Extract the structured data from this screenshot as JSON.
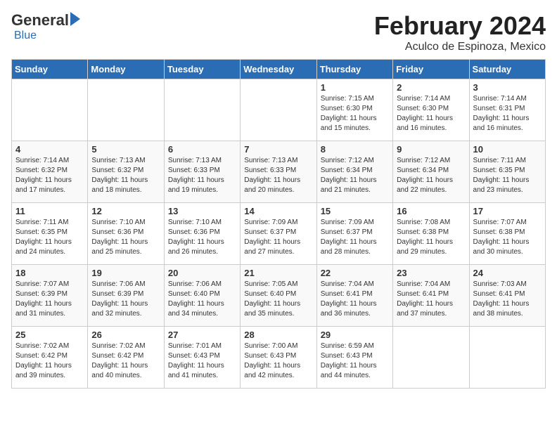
{
  "logo": {
    "general": "General",
    "blue": "Blue"
  },
  "header": {
    "month": "February 2024",
    "location": "Aculco de Espinoza, Mexico"
  },
  "weekdays": [
    "Sunday",
    "Monday",
    "Tuesday",
    "Wednesday",
    "Thursday",
    "Friday",
    "Saturday"
  ],
  "weeks": [
    [
      {
        "day": "",
        "info": ""
      },
      {
        "day": "",
        "info": ""
      },
      {
        "day": "",
        "info": ""
      },
      {
        "day": "",
        "info": ""
      },
      {
        "day": "1",
        "info": "Sunrise: 7:15 AM\nSunset: 6:30 PM\nDaylight: 11 hours and 15 minutes."
      },
      {
        "day": "2",
        "info": "Sunrise: 7:14 AM\nSunset: 6:30 PM\nDaylight: 11 hours and 16 minutes."
      },
      {
        "day": "3",
        "info": "Sunrise: 7:14 AM\nSunset: 6:31 PM\nDaylight: 11 hours and 16 minutes."
      }
    ],
    [
      {
        "day": "4",
        "info": "Sunrise: 7:14 AM\nSunset: 6:32 PM\nDaylight: 11 hours and 17 minutes."
      },
      {
        "day": "5",
        "info": "Sunrise: 7:13 AM\nSunset: 6:32 PM\nDaylight: 11 hours and 18 minutes."
      },
      {
        "day": "6",
        "info": "Sunrise: 7:13 AM\nSunset: 6:33 PM\nDaylight: 11 hours and 19 minutes."
      },
      {
        "day": "7",
        "info": "Sunrise: 7:13 AM\nSunset: 6:33 PM\nDaylight: 11 hours and 20 minutes."
      },
      {
        "day": "8",
        "info": "Sunrise: 7:12 AM\nSunset: 6:34 PM\nDaylight: 11 hours and 21 minutes."
      },
      {
        "day": "9",
        "info": "Sunrise: 7:12 AM\nSunset: 6:34 PM\nDaylight: 11 hours and 22 minutes."
      },
      {
        "day": "10",
        "info": "Sunrise: 7:11 AM\nSunset: 6:35 PM\nDaylight: 11 hours and 23 minutes."
      }
    ],
    [
      {
        "day": "11",
        "info": "Sunrise: 7:11 AM\nSunset: 6:35 PM\nDaylight: 11 hours and 24 minutes."
      },
      {
        "day": "12",
        "info": "Sunrise: 7:10 AM\nSunset: 6:36 PM\nDaylight: 11 hours and 25 minutes."
      },
      {
        "day": "13",
        "info": "Sunrise: 7:10 AM\nSunset: 6:36 PM\nDaylight: 11 hours and 26 minutes."
      },
      {
        "day": "14",
        "info": "Sunrise: 7:09 AM\nSunset: 6:37 PM\nDaylight: 11 hours and 27 minutes."
      },
      {
        "day": "15",
        "info": "Sunrise: 7:09 AM\nSunset: 6:37 PM\nDaylight: 11 hours and 28 minutes."
      },
      {
        "day": "16",
        "info": "Sunrise: 7:08 AM\nSunset: 6:38 PM\nDaylight: 11 hours and 29 minutes."
      },
      {
        "day": "17",
        "info": "Sunrise: 7:07 AM\nSunset: 6:38 PM\nDaylight: 11 hours and 30 minutes."
      }
    ],
    [
      {
        "day": "18",
        "info": "Sunrise: 7:07 AM\nSunset: 6:39 PM\nDaylight: 11 hours and 31 minutes."
      },
      {
        "day": "19",
        "info": "Sunrise: 7:06 AM\nSunset: 6:39 PM\nDaylight: 11 hours and 32 minutes."
      },
      {
        "day": "20",
        "info": "Sunrise: 7:06 AM\nSunset: 6:40 PM\nDaylight: 11 hours and 34 minutes."
      },
      {
        "day": "21",
        "info": "Sunrise: 7:05 AM\nSunset: 6:40 PM\nDaylight: 11 hours and 35 minutes."
      },
      {
        "day": "22",
        "info": "Sunrise: 7:04 AM\nSunset: 6:41 PM\nDaylight: 11 hours and 36 minutes."
      },
      {
        "day": "23",
        "info": "Sunrise: 7:04 AM\nSunset: 6:41 PM\nDaylight: 11 hours and 37 minutes."
      },
      {
        "day": "24",
        "info": "Sunrise: 7:03 AM\nSunset: 6:41 PM\nDaylight: 11 hours and 38 minutes."
      }
    ],
    [
      {
        "day": "25",
        "info": "Sunrise: 7:02 AM\nSunset: 6:42 PM\nDaylight: 11 hours and 39 minutes."
      },
      {
        "day": "26",
        "info": "Sunrise: 7:02 AM\nSunset: 6:42 PM\nDaylight: 11 hours and 40 minutes."
      },
      {
        "day": "27",
        "info": "Sunrise: 7:01 AM\nSunset: 6:43 PM\nDaylight: 11 hours and 41 minutes."
      },
      {
        "day": "28",
        "info": "Sunrise: 7:00 AM\nSunset: 6:43 PM\nDaylight: 11 hours and 42 minutes."
      },
      {
        "day": "29",
        "info": "Sunrise: 6:59 AM\nSunset: 6:43 PM\nDaylight: 11 hours and 44 minutes."
      },
      {
        "day": "",
        "info": ""
      },
      {
        "day": "",
        "info": ""
      }
    ]
  ]
}
